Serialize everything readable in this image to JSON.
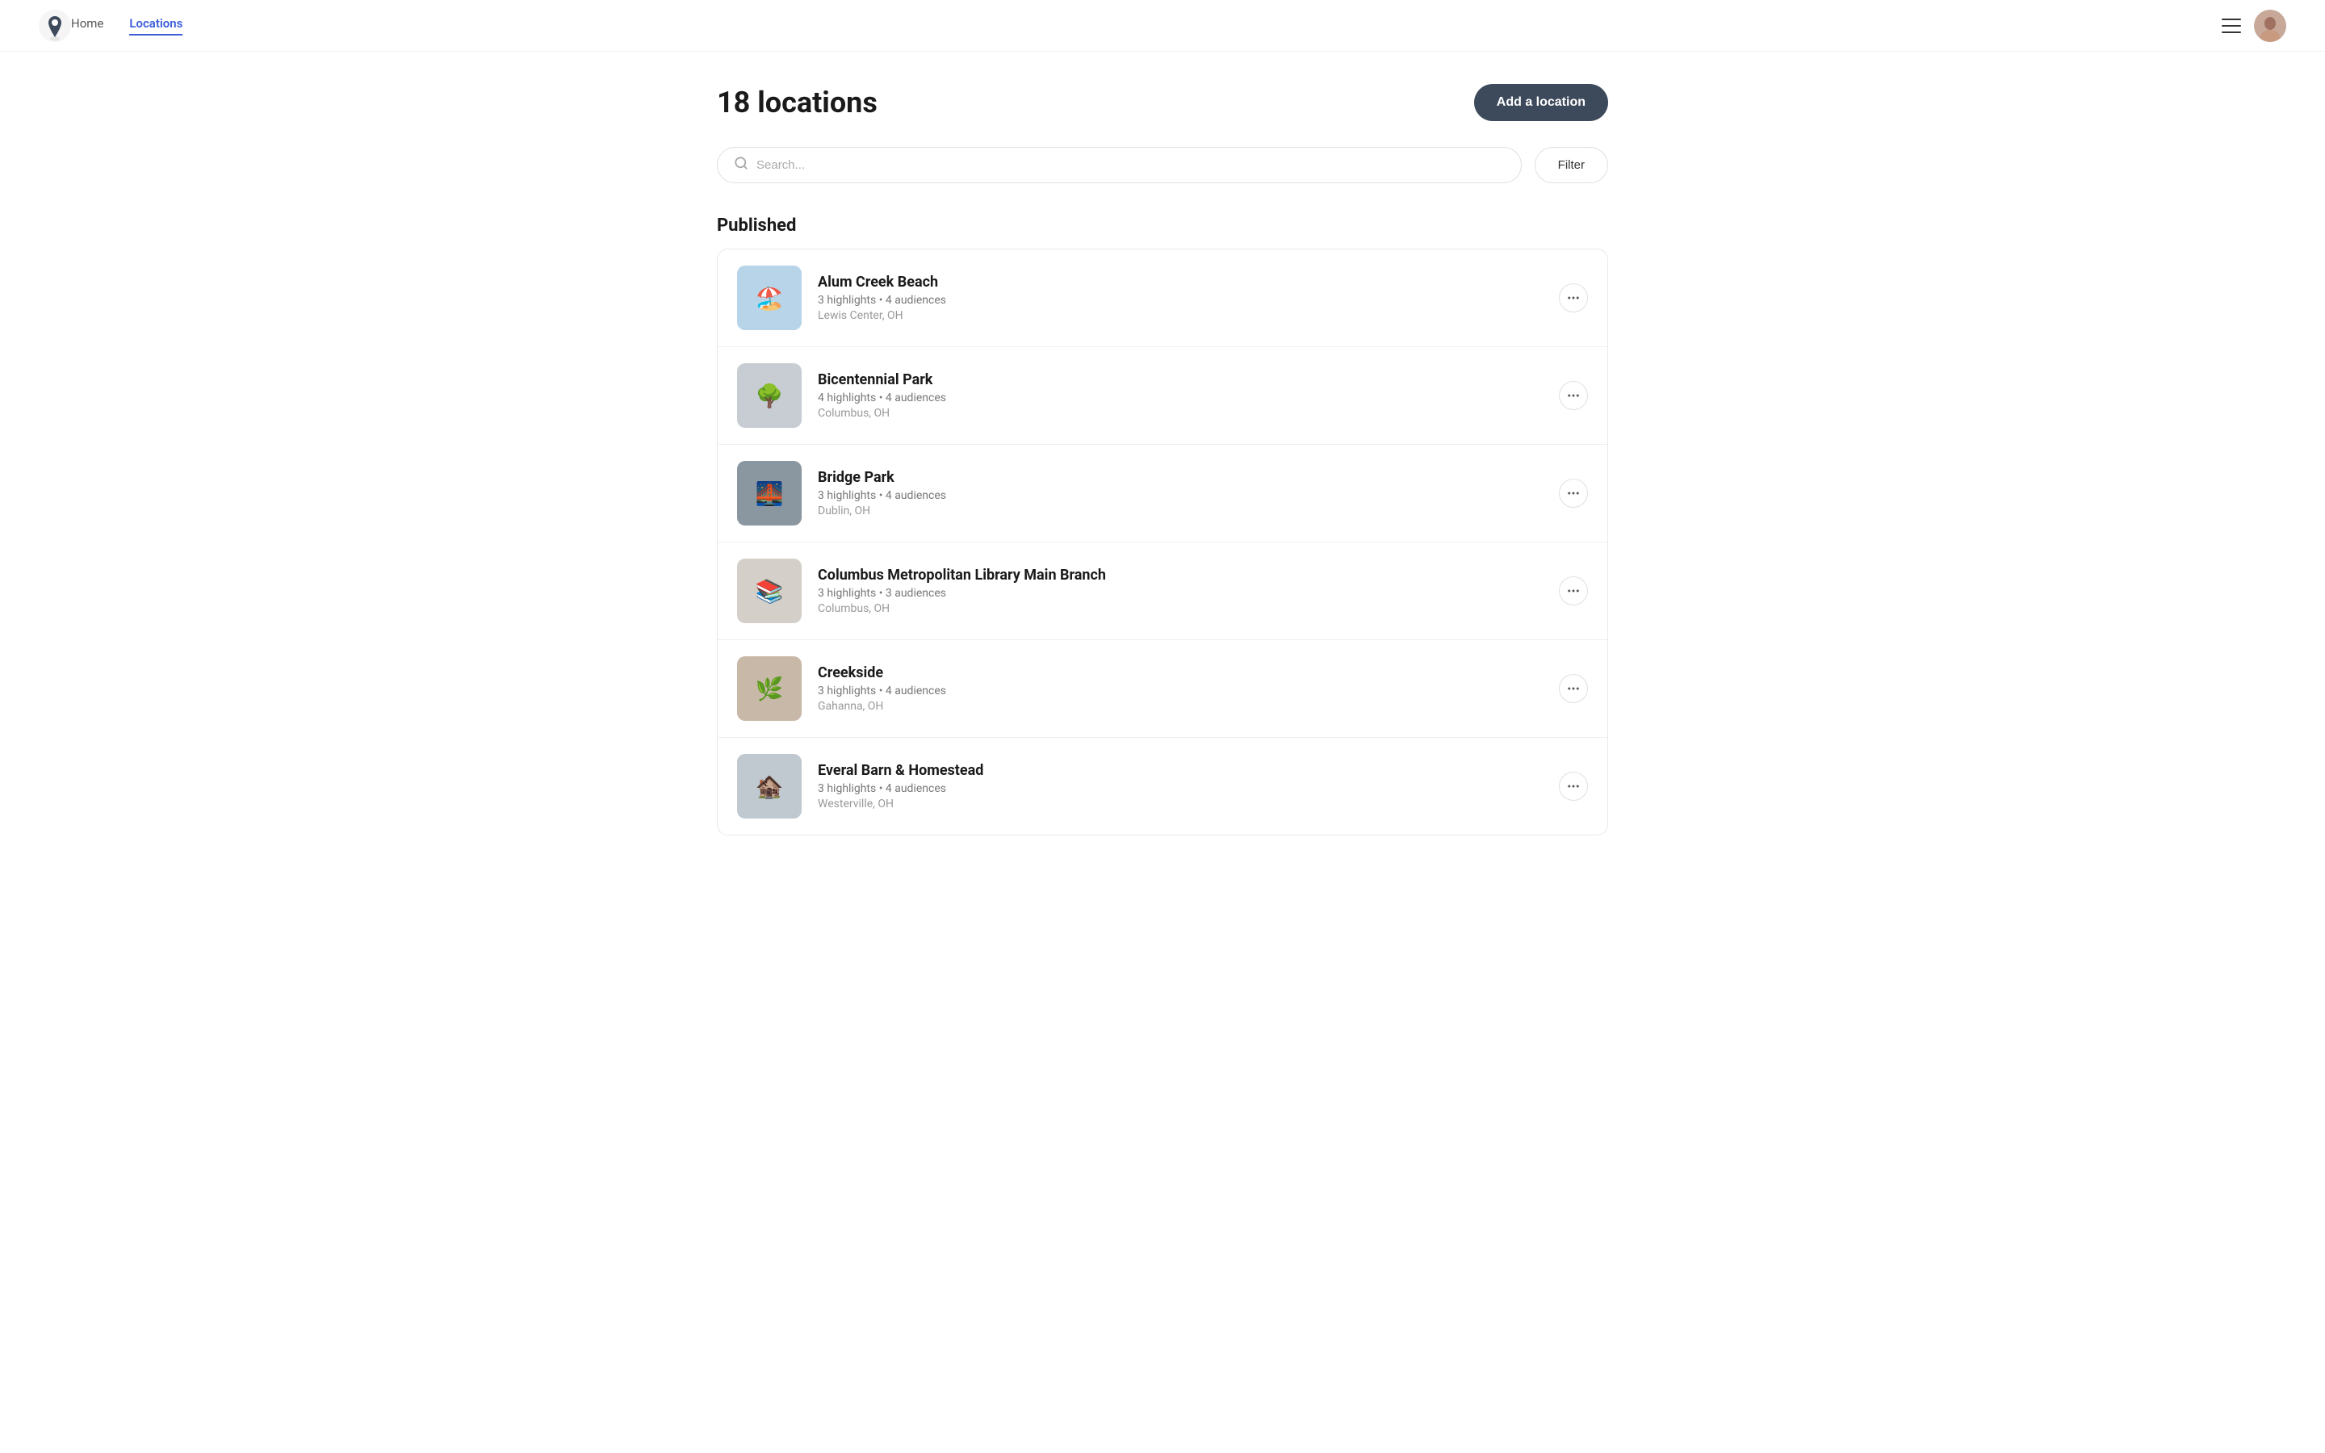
{
  "nav": {
    "home_label": "Home",
    "locations_label": "Locations",
    "active": "locations"
  },
  "page": {
    "title": "18 locations",
    "add_button_label": "Add a location"
  },
  "search": {
    "placeholder": "Search..."
  },
  "filter_button": "Filter",
  "published_section": {
    "label": "Published",
    "locations": [
      {
        "name": "Alum Creek Beach",
        "meta": "3 highlights • 4 audiences",
        "address": "Lewis Center, OH",
        "thumb_emoji": "🏖️",
        "thumb_class": "thumb-blue"
      },
      {
        "name": "Bicentennial Park",
        "meta": "4 highlights • 4 audiences",
        "address": "Columbus, OH",
        "thumb_emoji": "🌳",
        "thumb_class": "thumb-gray"
      },
      {
        "name": "Bridge Park",
        "meta": "3 highlights • 4 audiences",
        "address": "Dublin, OH",
        "thumb_emoji": "🌉",
        "thumb_class": "thumb-dark"
      },
      {
        "name": "Columbus Metropolitan Library Main Branch",
        "meta": "3 highlights • 3 audiences",
        "address": "Columbus, OH",
        "thumb_emoji": "📚",
        "thumb_class": "thumb-light"
      },
      {
        "name": "Creekside",
        "meta": "3 highlights • 4 audiences",
        "address": "Gahanna, OH",
        "thumb_emoji": "🌿",
        "thumb_class": "thumb-warm"
      },
      {
        "name": "Everal Barn & Homestead",
        "meta": "3 highlights • 4 audiences",
        "address": "Westerville, OH",
        "thumb_emoji": "🏚️",
        "thumb_class": "thumb-last"
      }
    ]
  },
  "more_button_label": "•••",
  "icons": {
    "search": "🔍",
    "hamburger_lines": 3,
    "pin_emoji": "📍"
  }
}
